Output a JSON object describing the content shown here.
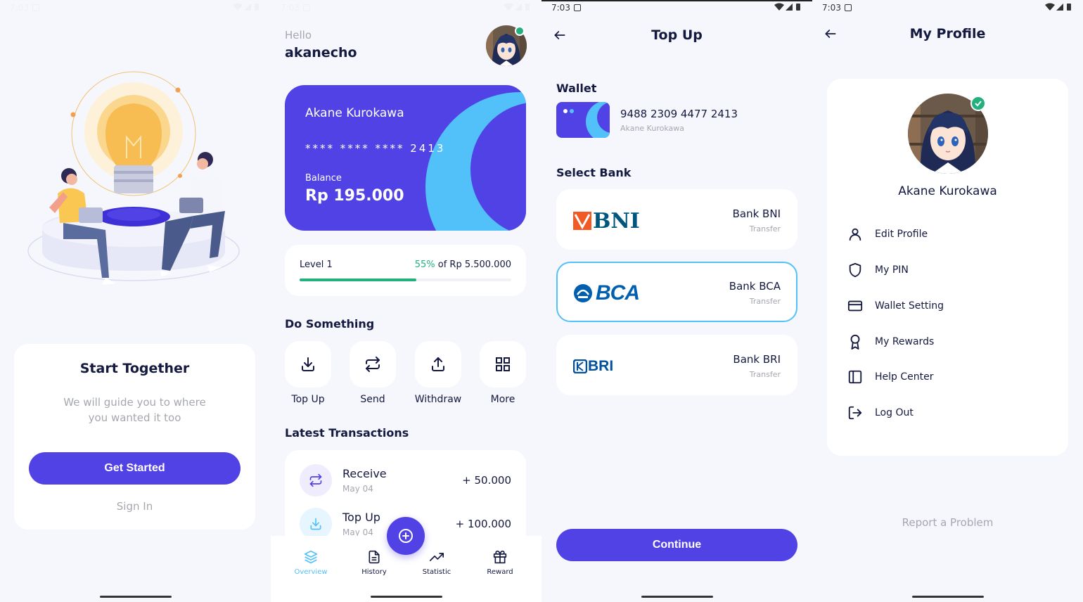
{
  "colors": {
    "primary": "#5142e6",
    "accent": "#53c1f9",
    "success": "#22b07d",
    "text": "#14193f",
    "muted": "#a4a8ae",
    "background": "#f6f7fc"
  },
  "onboarding": {
    "status_time": "7:03",
    "title": "Start Together",
    "subtitle": "We will guide you to where you wanted it too",
    "get_started": "Get Started",
    "sign_in": "Sign In"
  },
  "home": {
    "status_time": "7:03",
    "greeting": "Hello",
    "username": "akanecho",
    "card": {
      "holder": "Akane Kurokawa",
      "masked_number": "**** **** **** 2413",
      "balance_label": "Balance",
      "balance": "Rp 195.000"
    },
    "level": {
      "label": "Level 1",
      "percent_text": "55%",
      "target_text": "of Rp 5.500.000",
      "progress": 0.55
    },
    "do_something_title": "Do Something",
    "actions": [
      {
        "label": "Top Up",
        "icon": "download-icon"
      },
      {
        "label": "Send",
        "icon": "swap-icon"
      },
      {
        "label": "Withdraw",
        "icon": "upload-icon"
      },
      {
        "label": "More",
        "icon": "grid-icon"
      }
    ],
    "transactions_title": "Latest Transactions",
    "transactions": [
      {
        "title": "Receive",
        "date": "May 04",
        "amount": "+ 50.000",
        "icon": "swap-icon"
      },
      {
        "title": "Top Up",
        "date": "May 04",
        "amount": "+ 100.000",
        "icon": "download-icon"
      }
    ],
    "nav": [
      {
        "label": "Overview",
        "icon": "layers-icon",
        "active": true
      },
      {
        "label": "History",
        "icon": "document-icon",
        "active": false
      },
      {
        "label": "Statistic",
        "icon": "trending-up-icon",
        "active": false
      },
      {
        "label": "Reward",
        "icon": "gift-icon",
        "active": false
      }
    ]
  },
  "topup": {
    "status_time": "7:03",
    "title": "Top Up",
    "wallet_label": "Wallet",
    "wallet_number": "9488 2309 4477 2413",
    "wallet_owner": "Akane Kurokawa",
    "select_bank_label": "Select Bank",
    "banks": [
      {
        "logo_text": "BNI",
        "name": "Bank BNI",
        "type": "Transfer",
        "selected": false
      },
      {
        "logo_text": "BCA",
        "name": "Bank BCA",
        "type": "Transfer",
        "selected": true
      },
      {
        "logo_text": "BRI",
        "name": "Bank BRI",
        "type": "Transfer",
        "selected": false
      }
    ],
    "continue": "Continue"
  },
  "profile": {
    "status_time": "7:03",
    "title": "My Profile",
    "name": "Akane Kurokawa",
    "menu": [
      {
        "label": "Edit Profile",
        "icon": "user-icon"
      },
      {
        "label": "My PIN",
        "icon": "shield-icon"
      },
      {
        "label": "Wallet Setting",
        "icon": "credit-card-icon"
      },
      {
        "label": "My Rewards",
        "icon": "award-icon"
      },
      {
        "label": "Help Center",
        "icon": "sidebar-icon"
      },
      {
        "label": "Log Out",
        "icon": "logout-icon"
      }
    ],
    "report": "Report a Problem"
  }
}
